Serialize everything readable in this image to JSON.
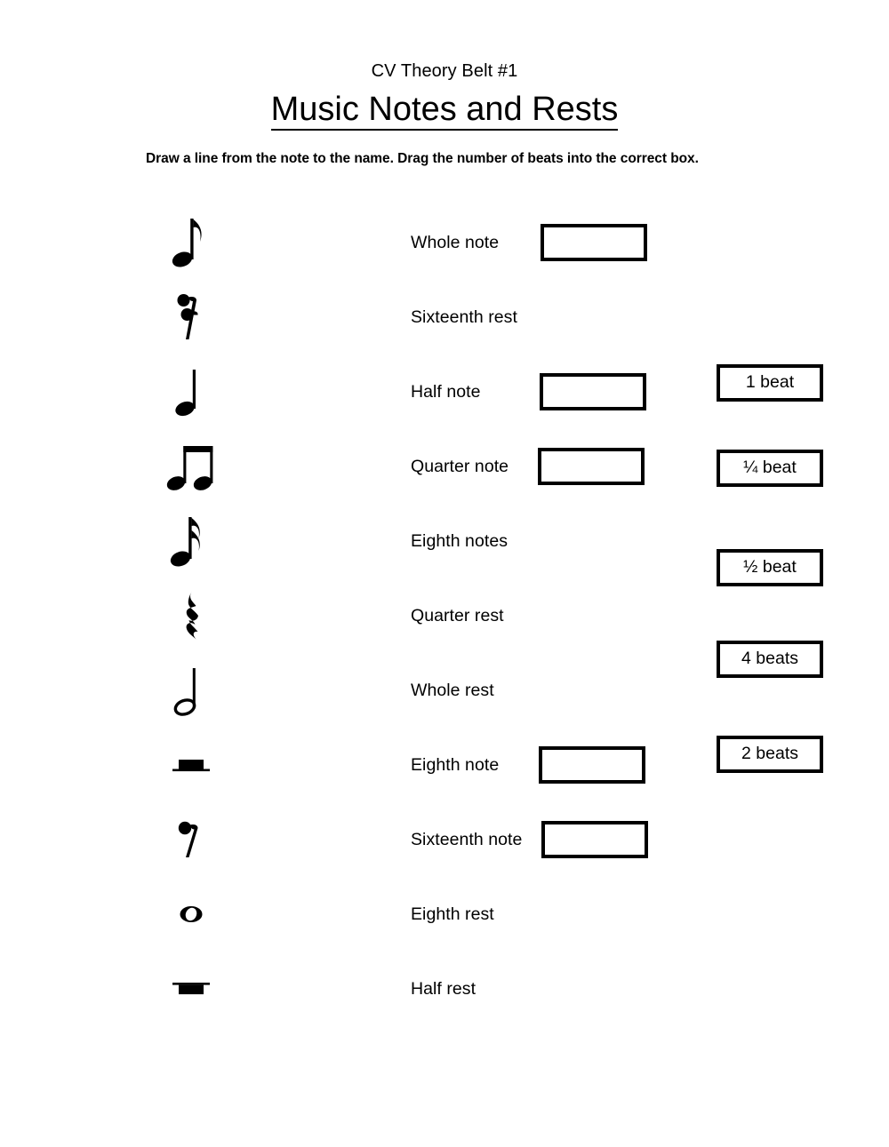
{
  "header": {
    "subtitle": "CV Theory Belt #1",
    "title": "Music Notes and Rests",
    "instructions": "Draw a line from the note to the name.  Drag the number of beats into the correct box."
  },
  "rows": [
    {
      "symbol": "eighth-note",
      "name": "Whole note",
      "has_answer_box": true
    },
    {
      "symbol": "sixteenth-rest",
      "name": "Sixteenth rest",
      "has_answer_box": false
    },
    {
      "symbol": "quarter-note",
      "name": "Half note",
      "has_answer_box": true
    },
    {
      "symbol": "beamed-eighth-notes",
      "name": "Quarter note",
      "has_answer_box": true
    },
    {
      "symbol": "sixteenth-note",
      "name": "Eighth notes",
      "has_answer_box": false
    },
    {
      "symbol": "quarter-rest",
      "name": "Quarter rest",
      "has_answer_box": false
    },
    {
      "symbol": "half-note",
      "name": "Whole rest",
      "has_answer_box": false
    },
    {
      "symbol": "half-rest",
      "name": "Eighth note",
      "has_answer_box": true
    },
    {
      "symbol": "eighth-rest",
      "name": "Sixteenth note",
      "has_answer_box": true
    },
    {
      "symbol": "whole-note",
      "name": "Eighth rest",
      "has_answer_box": false
    },
    {
      "symbol": "whole-rest",
      "name": "Half rest",
      "has_answer_box": false
    }
  ],
  "beat_boxes": [
    {
      "label": "1 beat"
    },
    {
      "label": "¼ beat"
    },
    {
      "label": "½ beat"
    },
    {
      "label": "4 beats"
    },
    {
      "label": "2 beats"
    }
  ],
  "colors": {
    "ink": "#000000",
    "page": "#ffffff"
  }
}
